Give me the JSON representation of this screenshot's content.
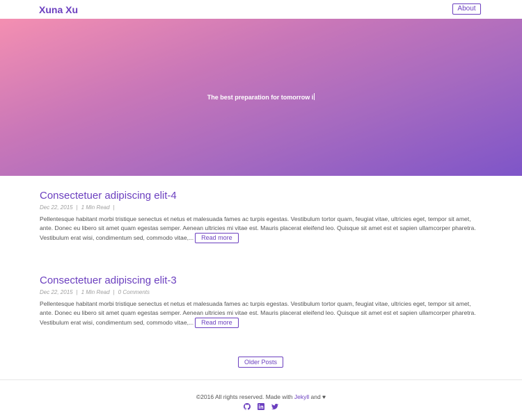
{
  "navbar": {
    "brand": "Xuna Xu",
    "about_label": "About"
  },
  "hero": {
    "tagline": "The best preparation for tomorrow i"
  },
  "posts": [
    {
      "title": "Consectetuer adipiscing elit-4",
      "date": "Dec 22, 2015",
      "read_time": "1 Min Read",
      "comments": "",
      "excerpt": "Pellentesque habitant morbi tristique senectus et netus et malesuada fames ac turpis egestas. Vestibulum tortor quam, feugiat vitae, ultricies eget, tempor sit amet, ante. Donec eu libero sit amet quam egestas semper. Aenean ultricies mi vitae est. Mauris placerat eleifend leo. Quisque sit amet est et sapien ullamcorper pharetra. Vestibulum erat wisi, condimentum sed, commodo vitae,...",
      "read_more": "Read more"
    },
    {
      "title": "Consectetuer adipiscing elit-3",
      "date": "Dec 22, 2015",
      "read_time": "1 Min Read",
      "comments": "0 Comments",
      "excerpt": "Pellentesque habitant morbi tristique senectus et netus et malesuada fames ac turpis egestas. Vestibulum tortor quam, feugiat vitae, ultricies eget, tempor sit amet, ante. Donec eu libero sit amet quam egestas semper. Aenean ultricies mi vitae est. Mauris placerat eleifend leo. Quisque sit amet est et sapien ullamcorper pharetra. Vestibulum erat wisi, condimentum sed, commodo vitae,...",
      "read_more": "Read more"
    }
  ],
  "pagination": {
    "older_label": "Older Posts"
  },
  "footer": {
    "copyright": "©2016 All rights reserved. Made with",
    "jekyll": "Jekyll",
    "and": "and",
    "heart": "♥",
    "icons": [
      "github-icon",
      "linkedin-icon",
      "twitter-icon"
    ]
  },
  "colors": {
    "accent": "#6b3fbf",
    "hero_gradient": [
      "#f48fb1",
      "#7e55c8"
    ]
  }
}
